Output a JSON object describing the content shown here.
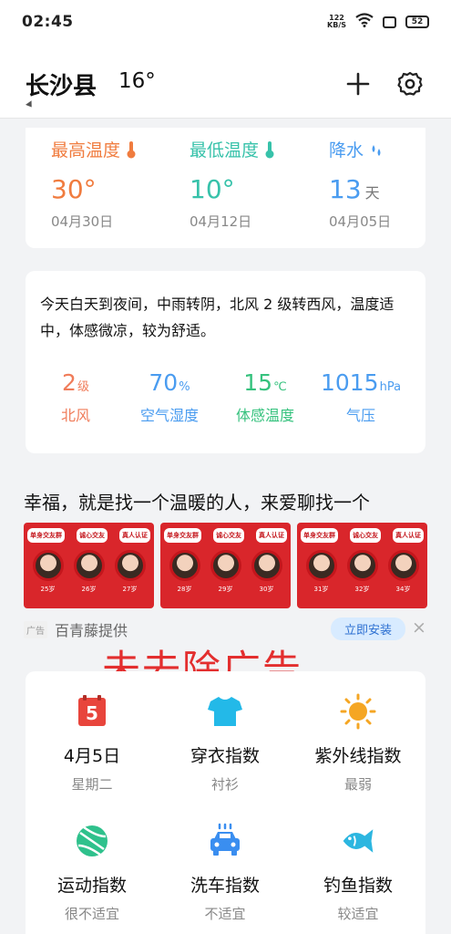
{
  "status": {
    "time": "02:45",
    "speed_value": "122",
    "speed_unit": "KB/S",
    "battery": "52"
  },
  "header": {
    "city": "长沙县",
    "temp": "16°"
  },
  "extremes": [
    {
      "title": "最高温度",
      "value": "30°",
      "unit": "",
      "date": "04月30日",
      "color": "#f07c3f"
    },
    {
      "title": "最低温度",
      "value": "10°",
      "unit": "",
      "date": "04月12日",
      "color": "#37c2aa"
    },
    {
      "title": "降水",
      "value": "13",
      "unit": "天",
      "date": "04月05日",
      "color": "#4a9cf0"
    }
  ],
  "summary": "今天白天到夜间，中雨转阴，北风 2 级转西风，温度适中，体感微凉，较为舒适。",
  "conditions": [
    {
      "value": "2",
      "unit": "级",
      "label": "北风",
      "color": "#f07c5a"
    },
    {
      "value": "70",
      "unit": "%",
      "label": "空气湿度",
      "color": "#4a9cf0"
    },
    {
      "value": "15",
      "unit": "℃",
      "label": "体感温度",
      "color": "#36c27e"
    },
    {
      "value": "1015",
      "unit": "hPa",
      "label": "气压",
      "color": "#4a9cf0"
    }
  ],
  "ad": {
    "title": "幸福，就是找一个温暖的人，来爱聊找一个",
    "tags": [
      "单身交友群",
      "诚心交友",
      "真人认证"
    ],
    "panels": [
      {
        "ages": [
          "25岁",
          "26岁",
          "27岁"
        ]
      },
      {
        "ages": [
          "28岁",
          "29岁",
          "30岁"
        ]
      },
      {
        "ages": [
          "31岁",
          "32岁",
          "34岁"
        ]
      }
    ],
    "badge": "广告",
    "source": "百青藤提供",
    "install": "立即安装",
    "close": "×"
  },
  "overlay": "未去除广告",
  "indices": [
    {
      "title": "4月5日",
      "sub": "星期二",
      "icon": "calendar-icon",
      "icon_text": "5"
    },
    {
      "title": "穿衣指数",
      "sub": "衬衫",
      "icon": "tshirt-icon"
    },
    {
      "title": "紫外线指数",
      "sub": "最弱",
      "icon": "sun-icon"
    },
    {
      "title": "运动指数",
      "sub": "很不适宜",
      "icon": "ball-icon"
    },
    {
      "title": "洗车指数",
      "sub": "不适宜",
      "icon": "car-wash-icon"
    },
    {
      "title": "钓鱼指数",
      "sub": "较适宜",
      "icon": "fish-icon"
    }
  ]
}
